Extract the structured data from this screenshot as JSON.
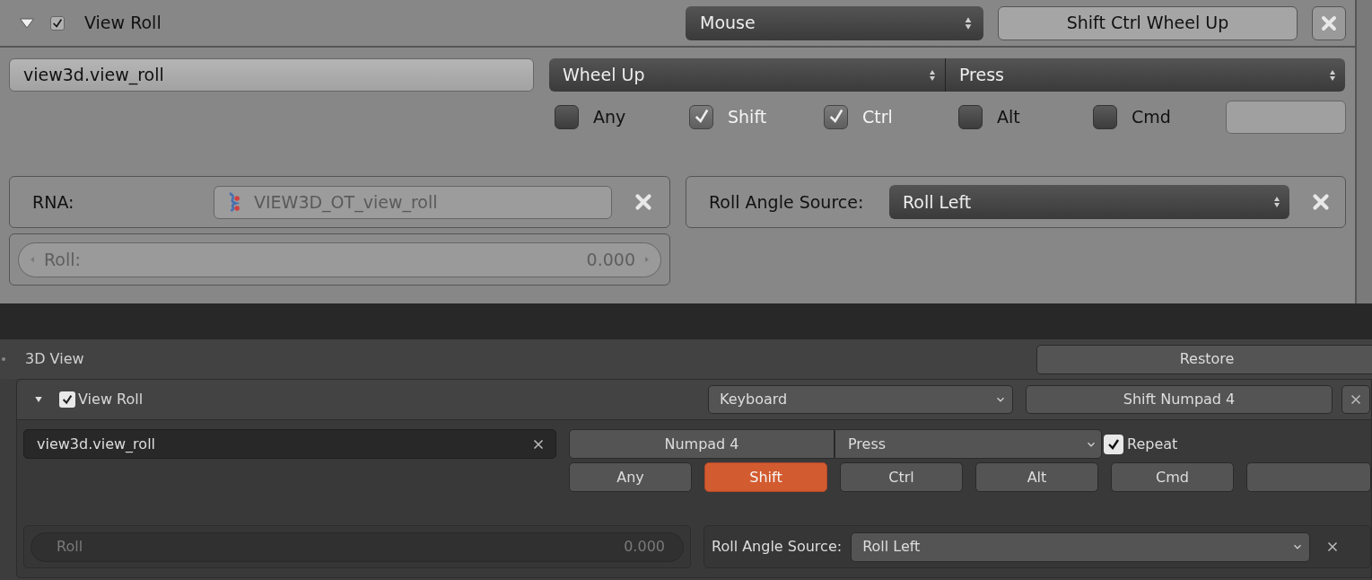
{
  "old_panel": {
    "item": {
      "expanded": true,
      "checked": true,
      "name": "View Roll"
    },
    "map_type": "Mouse",
    "shortcut": "Shift Ctrl Wheel Up",
    "operator": "view3d.view_roll",
    "event": "Wheel Up",
    "value": "Press",
    "modifiers": [
      {
        "label": "Any",
        "checked": false
      },
      {
        "label": "Shift",
        "checked": true
      },
      {
        "label": "Ctrl",
        "checked": true
      },
      {
        "label": "Alt",
        "checked": false
      },
      {
        "label": "Cmd",
        "checked": false
      }
    ],
    "rna": {
      "label": "RNA:",
      "value": "VIEW3D_OT_view_roll"
    },
    "property": {
      "label": "Roll:",
      "value": "0.000"
    },
    "roll_source": {
      "label": "Roll Angle Source:",
      "value": "Roll Left"
    }
  },
  "new_panel": {
    "section": "3D View",
    "restore": "Restore",
    "item": {
      "expanded": true,
      "checked": true,
      "name": "View Roll"
    },
    "map_type": "Keyboard",
    "shortcut": "Shift Numpad 4",
    "operator": "view3d.view_roll",
    "event": "Numpad 4",
    "value": "Press",
    "repeat": {
      "label": "Repeat",
      "checked": true
    },
    "modifiers": [
      {
        "label": "Any",
        "selected": false
      },
      {
        "label": "Shift",
        "selected": true
      },
      {
        "label": "Ctrl",
        "selected": false
      },
      {
        "label": "Alt",
        "selected": false
      },
      {
        "label": "Cmd",
        "selected": false
      }
    ],
    "property": {
      "label": "Roll",
      "value": "0.000"
    },
    "roll_source": {
      "label": "Roll Angle Source:",
      "value": "Roll Left"
    }
  }
}
